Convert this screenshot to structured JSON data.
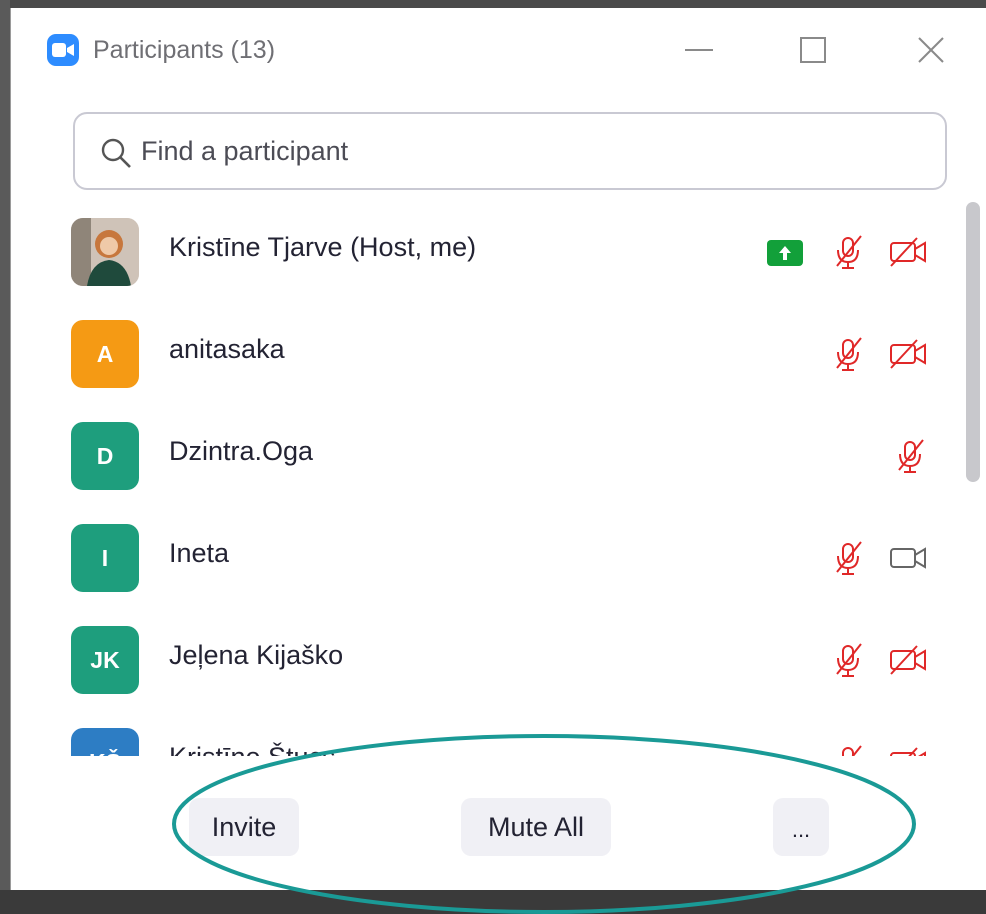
{
  "window": {
    "title": "Participants (13)"
  },
  "search": {
    "placeholder": "Find a participant"
  },
  "participants": [
    {
      "name": "Kristīne Tjarve (Host, me)",
      "avatar_type": "photo",
      "avatar_initials": "",
      "avatar_color": "#8a6a55",
      "sharing": true,
      "mic": "muted",
      "video": "off"
    },
    {
      "name": "anitasaka",
      "avatar_type": "initials",
      "avatar_initials": "A",
      "avatar_color": "#f59a14",
      "sharing": false,
      "mic": "muted",
      "video": "off"
    },
    {
      "name": "Dzintra.Oga",
      "avatar_type": "initials",
      "avatar_initials": "D",
      "avatar_color": "#1e9e7d",
      "sharing": false,
      "mic": "muted",
      "video": "none"
    },
    {
      "name": "Ineta",
      "avatar_type": "initials",
      "avatar_initials": "I",
      "avatar_color": "#1e9e7d",
      "sharing": false,
      "mic": "muted",
      "video": "on"
    },
    {
      "name": "Jeļena Kijaško",
      "avatar_type": "initials",
      "avatar_initials": "JK",
      "avatar_color": "#1e9e7d",
      "sharing": false,
      "mic": "muted",
      "video": "off"
    },
    {
      "name": "Kristīne Štucs",
      "avatar_type": "initials",
      "avatar_initials": "KŠ",
      "avatar_color": "#2d7dc4",
      "sharing": false,
      "mic": "muted",
      "video": "off"
    }
  ],
  "footer": {
    "invite_label": "Invite",
    "mute_all_label": "Mute All",
    "more_label": "..."
  },
  "colors": {
    "muted_red": "#e02828",
    "share_green": "#12a03a",
    "highlight_ellipse": "#1a9a96",
    "brand_blue": "#2d8cff"
  },
  "icons": [
    "app-icon",
    "minimize-icon",
    "maximize-icon",
    "close-icon",
    "search-icon",
    "share-screen-icon",
    "mic-muted-icon",
    "video-off-icon",
    "video-on-icon"
  ]
}
